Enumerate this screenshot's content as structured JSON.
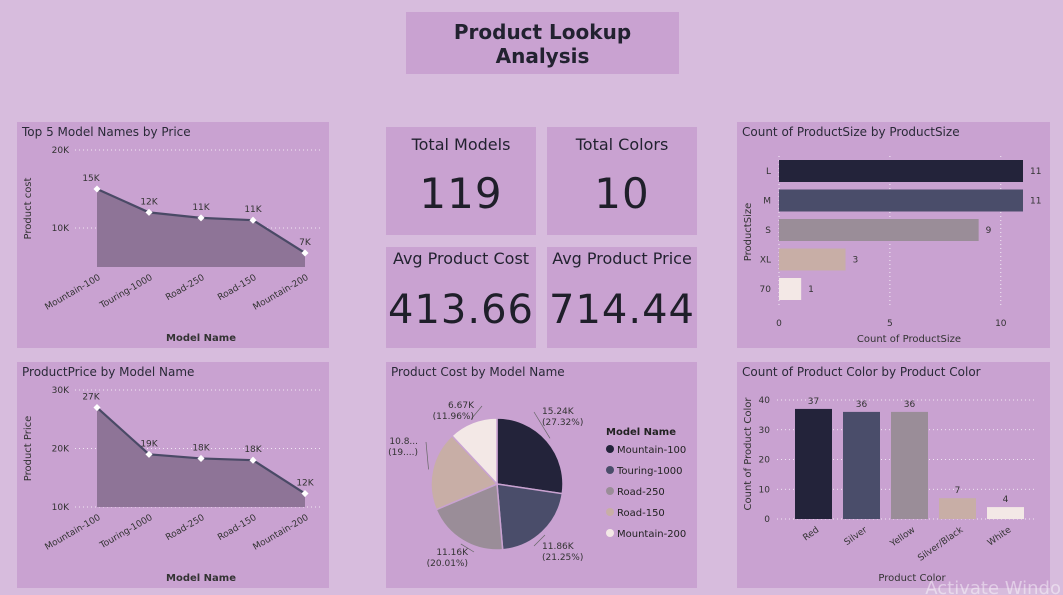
{
  "page_title": "Product Lookup Analysis",
  "watermark": "Activate Windo",
  "cards": {
    "total_models": {
      "label": "Total Models",
      "value": "119"
    },
    "total_colors": {
      "label": "Total Colors",
      "value": "10"
    },
    "avg_cost": {
      "label": "Avg Product Cost",
      "value": "413.66"
    },
    "avg_price": {
      "label": "Avg Product Price",
      "value": "714.44"
    }
  },
  "colors": {
    "panel": "#c9a2d1",
    "area": "#8e7497",
    "line": "#4a4a66",
    "grid": "#ffffff"
  },
  "chart_data": [
    {
      "type": "area",
      "title": "Top 5 Model Names by Price",
      "xlabel": "Model Name",
      "ylabel": "Product cost",
      "categories": [
        "Mountain-100",
        "Touring-1000",
        "Road-250",
        "Road-150",
        "Mountain-200"
      ],
      "values": [
        15,
        12,
        11.3,
        11,
        6.8
      ],
      "data_labels": [
        "15K",
        "12K",
        "11K",
        "11K",
        "7K"
      ],
      "yticks": [
        "20K",
        "10K"
      ],
      "ytick_values": [
        20,
        10
      ],
      "ylim": [
        5,
        20
      ]
    },
    {
      "type": "area",
      "title": "ProductPrice by Model Name",
      "xlabel": "Model Name",
      "ylabel": "Product Price",
      "categories": [
        "Mountain-100",
        "Touring-1000",
        "Road-250",
        "Road-150",
        "Mountain-200"
      ],
      "values": [
        27,
        19,
        18.3,
        18,
        12.3
      ],
      "data_labels": [
        "27K",
        "19K",
        "18K",
        "18K",
        "12K"
      ],
      "yticks": [
        "30K",
        "20K",
        "10K"
      ],
      "ytick_values": [
        30,
        20,
        10
      ],
      "ylim": [
        10,
        30
      ]
    },
    {
      "type": "pie",
      "title": "Product Cost by Model Name",
      "legend_title": "Model Name",
      "slices": [
        {
          "name": "Mountain-100",
          "value": 15.24,
          "label": "15.24K",
          "pct": "(27.32%)",
          "color": "#23233a"
        },
        {
          "name": "Touring-1000",
          "value": 11.86,
          "label": "11.86K",
          "pct": "(21.25%)",
          "color": "#4a4d6a"
        },
        {
          "name": "Road-250",
          "value": 11.16,
          "label": "11.16K",
          "pct": "(20.01%)",
          "color": "#9a8d98"
        },
        {
          "name": "Road-150",
          "value": 10.8,
          "label": "10.8...",
          "pct": "(19....)",
          "color": "#c8aea6"
        },
        {
          "name": "Mountain-200",
          "value": 6.67,
          "label": "6.67K",
          "pct": "(11.96%)",
          "color": "#f3e8e6"
        }
      ]
    },
    {
      "type": "bar",
      "orientation": "horizontal",
      "title": "Count of ProductSize by ProductSize",
      "xlabel": "Count of ProductSize",
      "ylabel": "ProductSize",
      "categories": [
        "L",
        "M",
        "S",
        "XL",
        "70"
      ],
      "values": [
        11,
        11,
        9,
        3,
        1
      ],
      "colors": [
        "#23233a",
        "#4a4d6a",
        "#9a8d98",
        "#c8aea6",
        "#f3e8e6"
      ],
      "xticks": [
        "0",
        "5",
        "10"
      ],
      "xtick_values": [
        0,
        5,
        10
      ],
      "xlim": [
        0,
        11
      ]
    },
    {
      "type": "bar",
      "orientation": "vertical",
      "title": "Count of Product Color by Product Color",
      "xlabel": "Product Color",
      "ylabel": "Count of Product Color",
      "categories": [
        "Red",
        "Silver",
        "Yellow",
        "Silver/Black",
        "White"
      ],
      "values": [
        37,
        36,
        36,
        7,
        4
      ],
      "colors": [
        "#23233a",
        "#4a4d6a",
        "#9a8d98",
        "#c8aea6",
        "#f3e8e6"
      ],
      "yticks": [
        "40",
        "30",
        "20",
        "10",
        "0"
      ],
      "ytick_values": [
        40,
        30,
        20,
        10,
        0
      ],
      "ylim": [
        0,
        40
      ]
    }
  ]
}
